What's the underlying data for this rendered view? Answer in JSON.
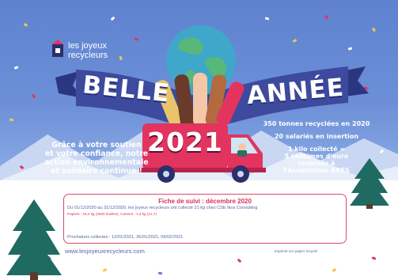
{
  "logo": {
    "line1": "les joyeux",
    "line2": "recycleurs"
  },
  "banner": {
    "left_word": "BELLE",
    "right_word": "ANNÉE"
  },
  "truck": {
    "year": "2021"
  },
  "left_message": {
    "line1": "Grâce à votre soutien",
    "line2": "et votre confiance, notre",
    "line3": "action environnementale",
    "line4": "et solidaire continue !"
  },
  "stats": {
    "tonnes": "350 tonnes recyclées en 2020",
    "salaries": "20 salariés en insertion",
    "kilo_line1": "1 kilo collecté =",
    "kilo_line2": "5 centimes d'euro",
    "kilo_line3": "reversés à",
    "kilo_line4": "l'Association ARES"
  },
  "info": {
    "title": "Fiche de suivi : décembre 2020",
    "line1": "Du 01/12/2020 au 31/12/2020, les joyeux recycleurs ont collecté 21 kg chez CSE Ikos Consulting",
    "line2": "Papiers : 19,4 kg (3930 feuilles), Cartons : 1,3 kg (21,7)",
    "line3": "Prochaines collectes : 12/01/2021, 26/01/2021, 09/02/2021"
  },
  "footer": {
    "website": "www.lesjoyeuxrecycleurs.com",
    "printed": "Imprimé sur papier recyclé"
  },
  "colors": {
    "sky": "#6c8fd8",
    "banner": "#3d4a9e",
    "truck": "#e2345f",
    "accent_pink": "#d92f5e",
    "text_blue": "#5565a8",
    "tree": "#1f6b62"
  }
}
